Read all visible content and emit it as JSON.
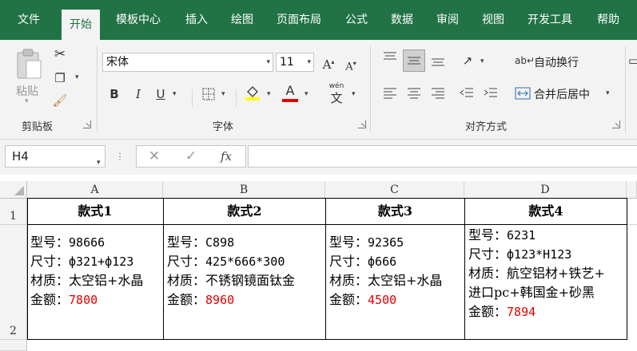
{
  "tabs": [
    "文件",
    "开始",
    "模板中心",
    "插入",
    "绘图",
    "页面布局",
    "公式",
    "数据",
    "审阅",
    "视图",
    "开发工具",
    "帮助"
  ],
  "clipboard": {
    "paste_label": "粘贴",
    "group_label": "剪贴板"
  },
  "font": {
    "name": "宋体",
    "size": "11",
    "group_label": "字体",
    "bold": "B",
    "italic": "I",
    "underline": "U",
    "font_color_letter": "A",
    "wen": "wén",
    "wen_char": "文"
  },
  "align": {
    "wrap_label": "自动换行",
    "merge_label": "合并后居中",
    "group_label": "对齐方式"
  },
  "formula_bar": {
    "name_box": "H4",
    "fx": "fx",
    "value": ""
  },
  "columns": [
    "A",
    "B",
    "C",
    "D"
  ],
  "rows": [
    "1",
    "2"
  ],
  "table": {
    "headers": [
      "款式1",
      "款式2",
      "款式3",
      "款式4"
    ],
    "cells": [
      {
        "model_label": "型号：",
        "model": "98666",
        "size_label": "尺寸：",
        "size": "ф321+ф123",
        "material_label": "材质：",
        "material": "太空铝+水晶",
        "price_label": "金额：",
        "price": "7800"
      },
      {
        "model_label": "型号：",
        "model": "C898",
        "size_label": "尺寸：",
        "size": "425*666*300",
        "material_label": "材质：",
        "material": "不锈钢镜面钛金",
        "price_label": "金额：",
        "price": "8960"
      },
      {
        "model_label": "型号：",
        "model": "92365",
        "size_label": "尺寸：",
        "size": "ф666",
        "material_label": "材质：",
        "material": "太空铝+水晶",
        "price_label": "金额：",
        "price": "4500"
      },
      {
        "model_label": "型号：",
        "model": "6231",
        "size_label": "尺寸：",
        "size": "ф123*H123",
        "material_label": "材质：",
        "material": "航空铝材+铁艺+",
        "material2": "进口pc+韩国金+砂黑",
        "price_label": "金额：",
        "price": "7894"
      }
    ]
  },
  "colors": {
    "excel_green": "#217346",
    "price_red": "#e00000"
  }
}
